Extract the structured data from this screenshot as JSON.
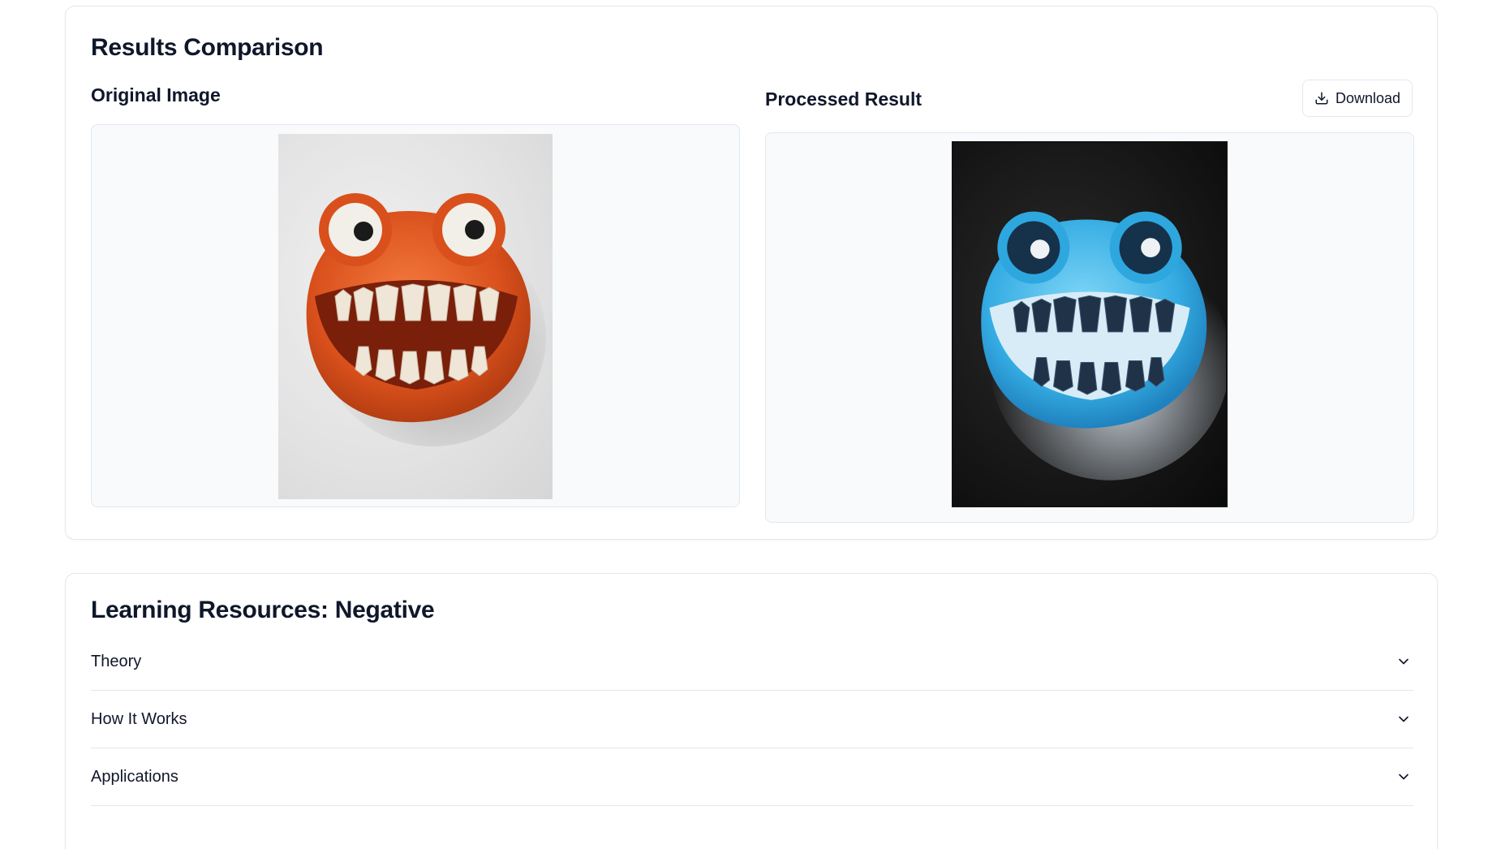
{
  "results": {
    "title": "Results Comparison",
    "original_label": "Original Image",
    "processed_label": "Processed Result",
    "download_label": "Download"
  },
  "learning": {
    "title": "Learning Resources: Negative",
    "items": [
      {
        "label": "Theory",
        "icon": "chevron-down-icon"
      },
      {
        "label": "How It Works",
        "icon": "chevron-down-icon"
      },
      {
        "label": "Applications",
        "icon": "chevron-down-icon"
      }
    ]
  },
  "colors": {
    "original_face": "#e25a22",
    "processed_face": "#3ab3e6",
    "border": "#e5e7eb",
    "frame_bg": "#f8fafc"
  }
}
